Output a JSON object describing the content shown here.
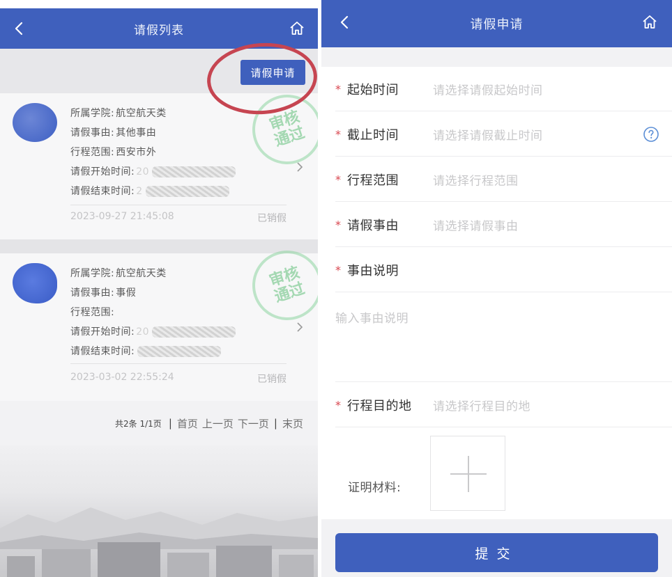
{
  "colors": {
    "primary": "#3f60bd",
    "required_star": "#d8454e",
    "annotation_red": "#c64551",
    "stamp_green": "#61c07a"
  },
  "left": {
    "title": "请假列表",
    "apply_button": "请假申请",
    "stamp_text": "审核通过",
    "records": [
      {
        "college_label": "所属学院:",
        "college": "航空航天类",
        "reason_label": "请假事由:",
        "reason": "其他事由",
        "range_label": "行程范围:",
        "range": "西安市外",
        "start_label": "请假开始时间:",
        "start": "20",
        "end_label": "请假结束时间:",
        "end": "2",
        "time": "2023-09-27 21:45:08",
        "status": "已销假"
      },
      {
        "college_label": "所属学院:",
        "college": "航空航天类",
        "reason_label": "请假事由:",
        "reason": "事假",
        "range_label": "行程范围:",
        "range": "",
        "start_label": "请假开始时间:",
        "start": "20",
        "end_label": "请假结束时间:",
        "end": "",
        "time": "2023-03-02 22:55:24",
        "status": "已销假"
      }
    ],
    "pager": {
      "count": "共2条 1/1页",
      "first": "首页",
      "prev": "上一页",
      "next": "下一页",
      "last": "末页",
      "sep": "|"
    }
  },
  "right": {
    "title": "请假申请",
    "fields": [
      {
        "label": "起始时间",
        "placeholder": "请选择请假起始时间"
      },
      {
        "label": "截止时间",
        "placeholder": "请选择请假截止时间"
      },
      {
        "label": "行程范围",
        "placeholder": "请选择行程范围"
      },
      {
        "label": "请假事由",
        "placeholder": "请选择请假事由"
      },
      {
        "label": "事由说明",
        "placeholder": ""
      }
    ],
    "reason_textarea_placeholder": "输入事由说明",
    "destination": {
      "label": "行程目的地",
      "placeholder": "请选择行程目的地"
    },
    "proof_label": "证明材料:",
    "submit": "提交",
    "required_mark": "*"
  }
}
